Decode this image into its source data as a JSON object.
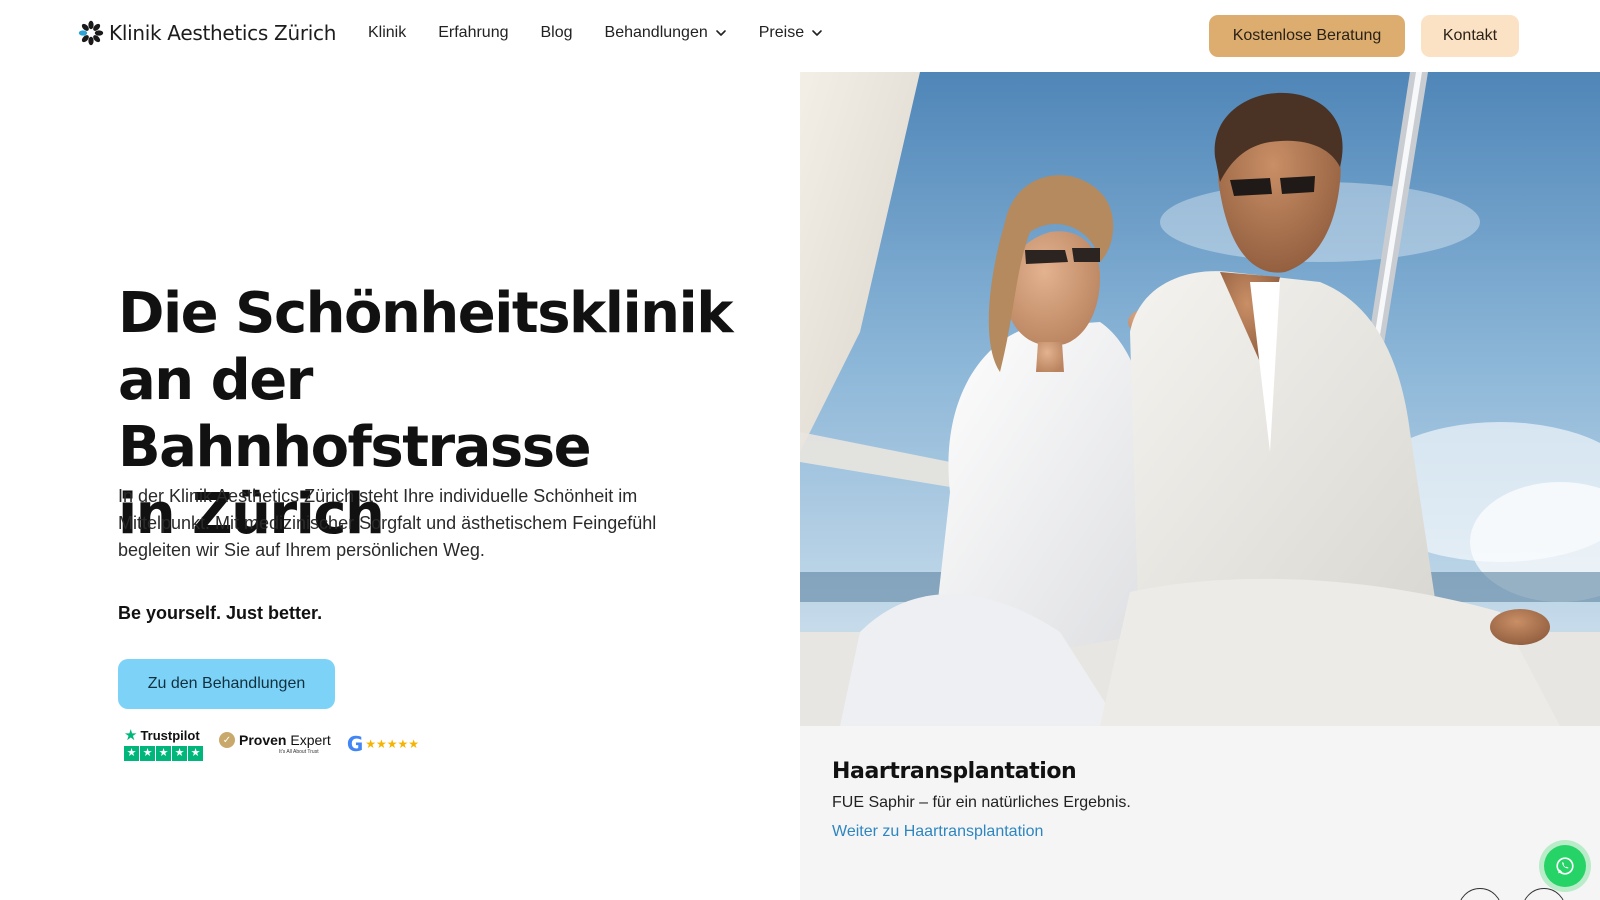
{
  "header": {
    "logo_text": "Klinik Aesthetics Zürich",
    "nav": [
      {
        "label": "Klinik",
        "has_dropdown": false
      },
      {
        "label": "Erfahrung",
        "has_dropdown": false
      },
      {
        "label": "Blog",
        "has_dropdown": false
      },
      {
        "label": "Behandlungen",
        "has_dropdown": true
      },
      {
        "label": "Preise",
        "has_dropdown": true
      }
    ],
    "cta_primary": "Kostenlose Beratung",
    "cta_secondary": "Kontakt"
  },
  "hero": {
    "title_lines": [
      "Die Schönheitsklinik",
      "an der Bahnhofstrasse",
      "in Zürich"
    ],
    "lead": "In der Klinik Aesthetics Zürich steht Ihre individuelle Schönheit im Mittelpunkt. Mit medizinischer Sorgfalt und ästhetischem Feingefühl begleiten wir Sie auf Ihrem persönlichen Weg.",
    "tagline": "Be yourself. Just better.",
    "button": "Zu den Behandlungen",
    "badges": {
      "trustpilot": "Trustpilot",
      "proven_expert_bold": "Proven",
      "proven_expert_rest": " Expert",
      "proven_expert_sub": "It's All About Trust",
      "google_letter": "G",
      "google_stars": "★★★★★"
    }
  },
  "card": {
    "title": "Haartransplantation",
    "subtitle": "FUE Saphir – für ein natürliches Ergebnis.",
    "link": "Weiter zu Haartransplantation"
  },
  "colors": {
    "accent_gold": "#dcad6f",
    "accent_peach": "#fce2c4",
    "accent_sky": "#7dd3f7",
    "link_blue": "#2e86c1",
    "whatsapp_green": "#25d366"
  },
  "icons": [
    "logo-mark-icon",
    "chevron-down-icon",
    "trustpilot-star-icon",
    "check-icon",
    "google-g-icon",
    "whatsapp-icon",
    "arrow-left-icon",
    "arrow-right-icon"
  ]
}
